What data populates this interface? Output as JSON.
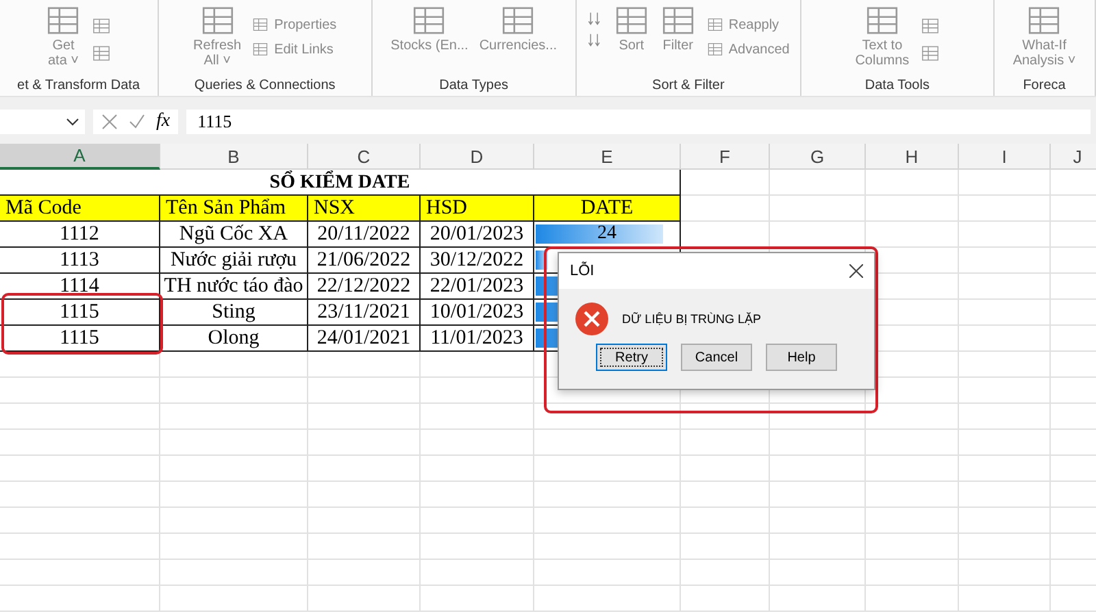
{
  "ribbon": {
    "groups": [
      {
        "label": "et & Transform Data",
        "items": [
          {
            "kind": "large",
            "label": "Get",
            "sub": "ata ˅"
          },
          {
            "kind": "iconset"
          }
        ]
      },
      {
        "label": "Queries & Connections",
        "items": [
          {
            "kind": "large",
            "label": "Refresh",
            "sub": "All ˅"
          },
          {
            "kind": "small",
            "lines": [
              "Properties",
              "Edit Links"
            ]
          }
        ]
      },
      {
        "label": "Data Types",
        "items": [
          {
            "kind": "large",
            "label": "Stocks (En..."
          },
          {
            "kind": "large",
            "label": "Currencies..."
          }
        ]
      },
      {
        "label": "Sort & Filter",
        "items": [
          {
            "kind": "sortpair"
          },
          {
            "kind": "large",
            "label": "Sort"
          },
          {
            "kind": "large",
            "label": "Filter"
          },
          {
            "kind": "small",
            "lines": [
              "Reapply",
              "Advanced"
            ]
          }
        ]
      },
      {
        "label": "Data Tools",
        "items": [
          {
            "kind": "large",
            "label": "Text to",
            "sub": "Columns"
          },
          {
            "kind": "iconset"
          }
        ]
      },
      {
        "label": "Foreca",
        "items": [
          {
            "kind": "large",
            "label": "What-If",
            "sub": "Analysis ˅"
          }
        ]
      }
    ]
  },
  "formula_bar": {
    "function_label": "fx",
    "value": "1115"
  },
  "columns": [
    {
      "label": "A",
      "selected": true
    },
    {
      "label": "B",
      "selected": false
    },
    {
      "label": "C",
      "selected": false
    },
    {
      "label": "D",
      "selected": false
    },
    {
      "label": "E",
      "selected": false
    },
    {
      "label": "F",
      "selected": false
    },
    {
      "label": "G",
      "selected": false
    },
    {
      "label": "H",
      "selected": false
    },
    {
      "label": "I",
      "selected": false
    },
    {
      "label": "J",
      "selected": false
    }
  ],
  "sheet": {
    "title": "SỔ KIỂM DATE",
    "headers": [
      "Mã Code",
      "Tên Sản Phẩm",
      "NSX",
      "HSD",
      "DATE"
    ],
    "rows": [
      {
        "cells": [
          "1112",
          "Ngũ Cốc XA",
          "20/11/2022",
          "20/01/2023",
          "24"
        ],
        "level": 0.9
      },
      {
        "cells": [
          "1113",
          "Nước giải rượu",
          "21/06/2022",
          "30/12/2022"
        ],
        "level": 0.1
      },
      {
        "cells": [
          "1114",
          "TH nước táo đào",
          "22/12/2022",
          "22/01/2023"
        ],
        "level": 1
      },
      {
        "cells": [
          "1115",
          "Sting",
          "23/11/2021",
          "10/01/2023"
        ],
        "level": 1
      },
      {
        "cells": [
          "1115",
          "Olong",
          "24/01/2021",
          "11/01/2023"
        ],
        "level": 1
      }
    ]
  },
  "dialog": {
    "title": "LỖI",
    "message": "DỮ LIỆU BỊ TRÙNG LẶP",
    "buttons": [
      {
        "label": "Retry",
        "selected": true
      },
      {
        "label": "Cancel",
        "selected": false
      },
      {
        "label": "Help",
        "selected": false
      }
    ]
  }
}
